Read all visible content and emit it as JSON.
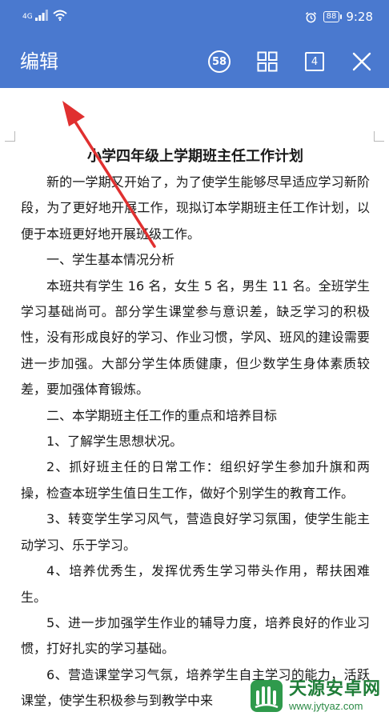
{
  "status_bar": {
    "signal_text": "4G",
    "battery": "88",
    "time": "9:28"
  },
  "toolbar": {
    "title": "编辑",
    "badge_count": "58",
    "page_count": "4"
  },
  "document": {
    "title": "小学四年级上学期班主任工作计划",
    "paragraphs": [
      "新的一学期又开始了，为了使学生能够尽早适应学习新阶段，为了更好地开展工作，现拟订本学期班主任工作计划，以便于本班更好地开展班级工作。",
      "一、学生基本情况分析",
      "本班共有学生 16 名，女生 5 名，男生 11 名。全班学生学习基础尚可。部分学生课堂参与意识差，缺乏学习的积极性，没有形成良好的学习、作业习惯，学风、班风的建设需要进一步加强。大部分学生体质健康，但少数学生身体素质较差，要加强体育锻炼。",
      "二、本学期班主任工作的重点和培养目标",
      "1、了解学生思想状况。",
      "2、抓好班主任的日常工作：组织好学生参加升旗和两操，检查本班学生值日生工作，做好个别学生的教育工作。",
      "3、转变学生学习风气，营造良好学习氛围，使学生能主动学习、乐于学习。",
      "4、培养优秀生，发挥优秀生学习带头作用，帮扶困难生。",
      "5、进一步加强学生作业的辅导力度，培养良好的作业习惯，打好扎实的学习基础。",
      "6、营造课堂学习气氛，培养学生自主学习的能力，活跃课堂，使学生积极参与到教学中来"
    ]
  },
  "watermark": {
    "name": "天源安卓网",
    "url": "www.jytyaz.com"
  },
  "colors": {
    "accent": "#4a79cf",
    "annotation_arrow": "#e03030",
    "watermark_green": "#1f7d38"
  }
}
